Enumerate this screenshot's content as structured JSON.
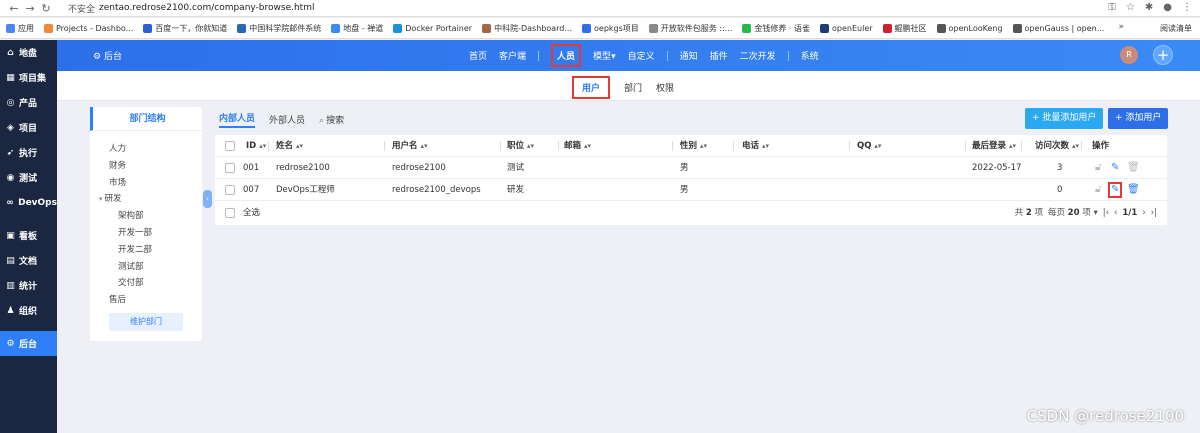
{
  "browser": {
    "insecure_label": "不安全",
    "url": "zentao.redrose2100.com/company-browse.html",
    "bookmarks": [
      {
        "label": "应用",
        "color": "#4a88f0"
      },
      {
        "label": "Projects - Dashbo...",
        "color": "#f08a3a"
      },
      {
        "label": "百度一下，你就知道",
        "color": "#2e5fd8"
      },
      {
        "label": "中国科学院邮件系统",
        "color": "#2a66b8"
      },
      {
        "label": "地盘 - 禅道",
        "color": "#3a8af6"
      },
      {
        "label": "Docker Portainer",
        "color": "#1c8fd8"
      },
      {
        "label": "中科院-Dashboard...",
        "color": "#a06848"
      },
      {
        "label": "oepkgs项目",
        "color": "#2e6fe8"
      },
      {
        "label": "开放软件包服务 ::...",
        "color": "#888888"
      },
      {
        "label": "金钱修养 · 语雀",
        "color": "#27b94d"
      },
      {
        "label": "openEuler",
        "color": "#1f3c7a"
      },
      {
        "label": "鲲鹏社区",
        "color": "#d02030"
      },
      {
        "label": "openLooKeng",
        "color": "#555555"
      },
      {
        "label": "openGauss | open...",
        "color": "#555555"
      }
    ],
    "more": "»",
    "reading_list": "阅读清单"
  },
  "sidebar": {
    "items": [
      {
        "icon": "home-icon",
        "glyph": "⌂",
        "label": "地盘"
      },
      {
        "icon": "program-icon",
        "glyph": "▦",
        "label": "项目集"
      },
      {
        "icon": "product-icon",
        "glyph": "◎",
        "label": "产品"
      },
      {
        "icon": "project-icon",
        "glyph": "◈",
        "label": "项目"
      },
      {
        "icon": "execution-icon",
        "glyph": "➹",
        "label": "执行"
      },
      {
        "icon": "test-icon",
        "glyph": "◉",
        "label": "测试"
      },
      {
        "icon": "devops-icon",
        "glyph": "∞",
        "label": "DevOps"
      },
      {
        "icon": "kanban-icon",
        "glyph": "▣",
        "label": "看板"
      },
      {
        "icon": "doc-icon",
        "glyph": "▤",
        "label": "文档"
      },
      {
        "icon": "stats-icon",
        "glyph": "▥",
        "label": "统计"
      },
      {
        "icon": "org-icon",
        "glyph": "♟",
        "label": "组织"
      },
      {
        "icon": "admin-icon",
        "glyph": "⚙",
        "label": "后台"
      }
    ]
  },
  "header": {
    "brand": "后台",
    "menu": [
      "首页",
      "客户端",
      "人员",
      "模型",
      "自定义",
      "通知",
      "插件",
      "二次开发",
      "系统"
    ],
    "model_caret": "▾",
    "avatar": "R",
    "plus": "+"
  },
  "subnav": {
    "items": [
      "用户",
      "部门",
      "权限"
    ]
  },
  "dept": {
    "title": "部门结构",
    "nodes": [
      {
        "label": "人力",
        "level": 0
      },
      {
        "label": "财务",
        "level": 0
      },
      {
        "label": "市场",
        "level": 0
      },
      {
        "label": "研发",
        "level": 0,
        "expanded": true
      },
      {
        "label": "架构部",
        "level": 1
      },
      {
        "label": "开发一部",
        "level": 1
      },
      {
        "label": "开发二部",
        "level": 1
      },
      {
        "label": "测试部",
        "level": 1
      },
      {
        "label": "交付部",
        "level": 1
      },
      {
        "label": "售后",
        "level": 0
      }
    ],
    "maintain": "维护部门",
    "collapse": "‹"
  },
  "tabs": {
    "internal": "内部人员",
    "external": "外部人员",
    "search": "搜索"
  },
  "buttons": {
    "batch_add": "+ 批量添加用户",
    "add": "+ 添加用户"
  },
  "table": {
    "columns": {
      "id": "ID",
      "name": "姓名",
      "account": "用户名",
      "role": "职位",
      "email": "邮箱",
      "gender": "性别",
      "phone": "电话",
      "qq": "QQ",
      "last": "最后登录",
      "visits": "访问次数",
      "actions": "操作"
    },
    "rows": [
      {
        "id": "001",
        "name": "redrose2100",
        "account": "redrose2100",
        "role": "测试",
        "gender": "男",
        "last": "2022-05-17",
        "visits": "3"
      },
      {
        "id": "007",
        "name": "DevOps工程师",
        "account": "redrose2100_devops",
        "role": "研发",
        "gender": "男",
        "last": "",
        "visits": "0"
      }
    ],
    "select_all": "全选",
    "pager": {
      "total_prefix": "共",
      "total": "2",
      "total_suffix": "项",
      "per_prefix": "每页",
      "per": "20",
      "per_suffix": "项",
      "page": "1/1"
    }
  },
  "watermark": "CSDN @redrose2100"
}
